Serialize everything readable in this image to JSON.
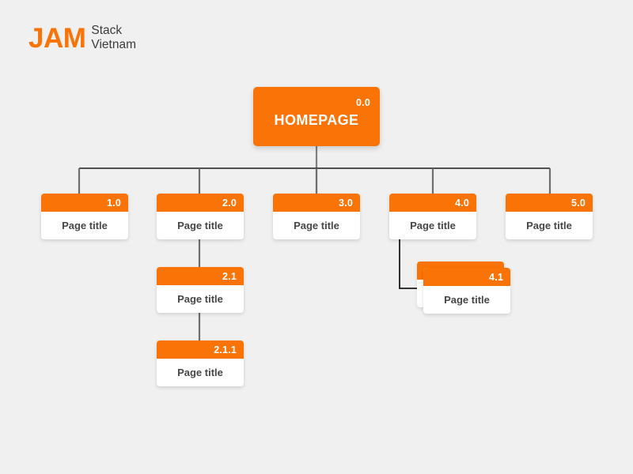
{
  "page": {
    "background_color": "#f0f0f0",
    "accent_color": "#f97306",
    "text_color": "#474747",
    "line_color": "#1a1a1a",
    "trunk_color": "#808080"
  },
  "logo": {
    "mark": "JAM",
    "line1": "Stack",
    "line2": "Vietnam"
  },
  "sitemap": {
    "root": {
      "number": "0.0",
      "title": "HOMEPAGE"
    },
    "nodes": [
      {
        "number": "1.0",
        "title": "Page title"
      },
      {
        "number": "2.0",
        "title": "Page title"
      },
      {
        "number": "3.0",
        "title": "Page title"
      },
      {
        "number": "4.0",
        "title": "Page title"
      },
      {
        "number": "5.0",
        "title": "Page title"
      },
      {
        "number": "2.1",
        "title": "Page title"
      },
      {
        "number": "2.1.1",
        "title": "Page title"
      },
      {
        "number": "4.1",
        "title": "Page title"
      }
    ]
  }
}
